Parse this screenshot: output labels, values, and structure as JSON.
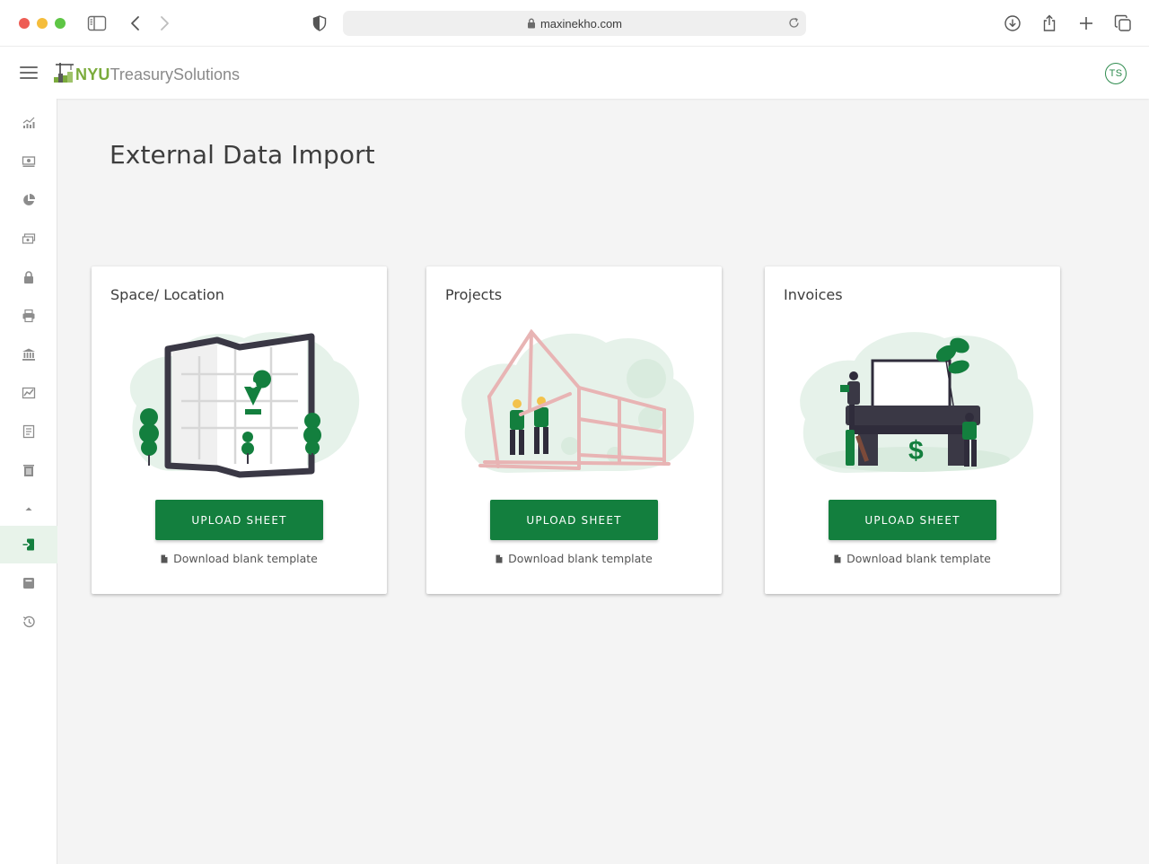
{
  "browser": {
    "url": "maxinekho.com"
  },
  "header": {
    "logo_primary": "NYU",
    "logo_secondary": "TreasurySolutions",
    "avatar_initials": "TS"
  },
  "sidebar": {
    "items": [
      {
        "icon": "line-chart-icon"
      },
      {
        "icon": "money-icon"
      },
      {
        "icon": "pie-chart-icon"
      },
      {
        "icon": "cash-icon"
      },
      {
        "icon": "lock-icon"
      },
      {
        "icon": "print-icon"
      },
      {
        "icon": "bank-icon"
      },
      {
        "icon": "image-chart-icon"
      },
      {
        "icon": "receipt-icon"
      },
      {
        "icon": "delete-icon"
      },
      {
        "icon": "caret-up-icon"
      },
      {
        "icon": "import-icon",
        "active": true
      },
      {
        "icon": "archive-icon"
      },
      {
        "icon": "history-icon"
      }
    ]
  },
  "main": {
    "title": "External Data Import",
    "cards": [
      {
        "title": "Space/ Location",
        "button": "UPLOAD SHEET",
        "link": "Download blank template"
      },
      {
        "title": "Projects",
        "button": "UPLOAD SHEET",
        "link": "Download blank template"
      },
      {
        "title": "Invoices",
        "button": "UPLOAD SHEET",
        "link": "Download blank template"
      }
    ]
  },
  "colors": {
    "brand_green": "#137f3e",
    "logo_green": "#7bab3c",
    "active_bg": "#e8f3ea"
  }
}
